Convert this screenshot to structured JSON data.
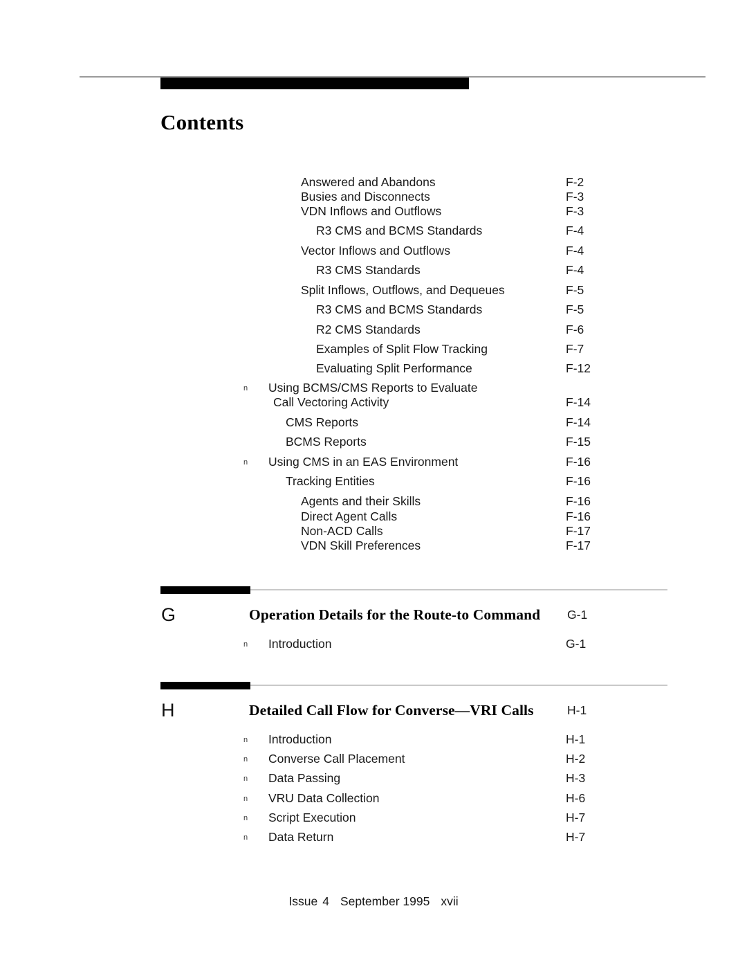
{
  "header": {
    "title": "Contents"
  },
  "toc": {
    "entries": [
      {
        "label": "Answered and Abandons",
        "page": "F-2",
        "level": 1,
        "bullet": false
      },
      {
        "label": "Busies and Disconnects",
        "page": "F-3",
        "level": 1,
        "bullet": false
      },
      {
        "label": "VDN Inflows and Outflows",
        "page": "F-3",
        "level": 1,
        "bullet": false
      },
      {
        "label": "R3 CMS and BCMS Standards",
        "page": "F-4",
        "level": 2,
        "bullet": false
      },
      {
        "label": "Vector Inflows and Outflows",
        "page": "F-4",
        "level": 1,
        "bullet": false
      },
      {
        "label": "R3 CMS Standards",
        "page": "F-4",
        "level": 2,
        "bullet": false
      },
      {
        "label": "Split Inflows, Outflows, and Dequeues",
        "page": "F-5",
        "level": 1,
        "bullet": false
      },
      {
        "label": "R3 CMS and BCMS Standards",
        "page": "F-5",
        "level": 2,
        "bullet": false
      },
      {
        "label": "R2 CMS Standards",
        "page": "F-6",
        "level": 2,
        "bullet": false
      },
      {
        "label": "Examples of Split Flow Tracking",
        "page": "F-7",
        "level": 2,
        "bullet": false
      },
      {
        "label": "Evaluating Split Performance",
        "page": "F-12",
        "level": 2,
        "bullet": false
      },
      {
        "label": "Using BCMS/CMS Reports to Evaluate",
        "page": "",
        "level": 0,
        "bullet": true
      },
      {
        "label": "Call Vectoring Activity",
        "page": "F-14",
        "level": 5,
        "bullet": false
      },
      {
        "label": "CMS Reports",
        "page": "F-14",
        "level": 3,
        "bullet": false
      },
      {
        "label": "BCMS Reports",
        "page": "F-15",
        "level": 3,
        "bullet": false
      },
      {
        "label": "Using CMS in an EAS Environment",
        "page": "F-16",
        "level": 0,
        "bullet": true
      },
      {
        "label": "Tracking Entities",
        "page": "F-16",
        "level": 3,
        "bullet": false
      },
      {
        "label": "Agents and their Skills",
        "page": "F-16",
        "level": 4,
        "bullet": false
      },
      {
        "label": "Direct Agent Calls",
        "page": "F-16",
        "level": 4,
        "bullet": false
      },
      {
        "label": "Non-ACD Calls",
        "page": "F-17",
        "level": 4,
        "bullet": false
      },
      {
        "label": "VDN Skill Preferences",
        "page": "F-17",
        "level": 4,
        "bullet": false
      }
    ]
  },
  "appendices": [
    {
      "letter": "G",
      "title": "Operation Details for the Route-to Command",
      "page": "G-1",
      "entries": [
        {
          "label": "Introduction",
          "page": "G-1",
          "level": 0,
          "bullet": true
        }
      ]
    },
    {
      "letter": "H",
      "title": "Detailed Call Flow for Converse—VRI Calls",
      "page": "H-1",
      "entries": [
        {
          "label": "Introduction",
          "page": "H-1",
          "level": 0,
          "bullet": true
        },
        {
          "label": "Converse Call Placement",
          "page": "H-2",
          "level": 0,
          "bullet": true
        },
        {
          "label": "Data Passing",
          "page": "H-3",
          "level": 0,
          "bullet": true
        },
        {
          "label": "VRU Data Collection",
          "page": "H-6",
          "level": 0,
          "bullet": true
        },
        {
          "label": "Script Execution",
          "page": "H-7",
          "level": 0,
          "bullet": true
        },
        {
          "label": "Data Return",
          "page": "H-7",
          "level": 0,
          "bullet": true
        }
      ]
    }
  ],
  "bullet_glyph": "n",
  "footer": {
    "issue_label": "Issue",
    "issue_number": "4",
    "date": "September 1995",
    "folio": "xvii"
  }
}
